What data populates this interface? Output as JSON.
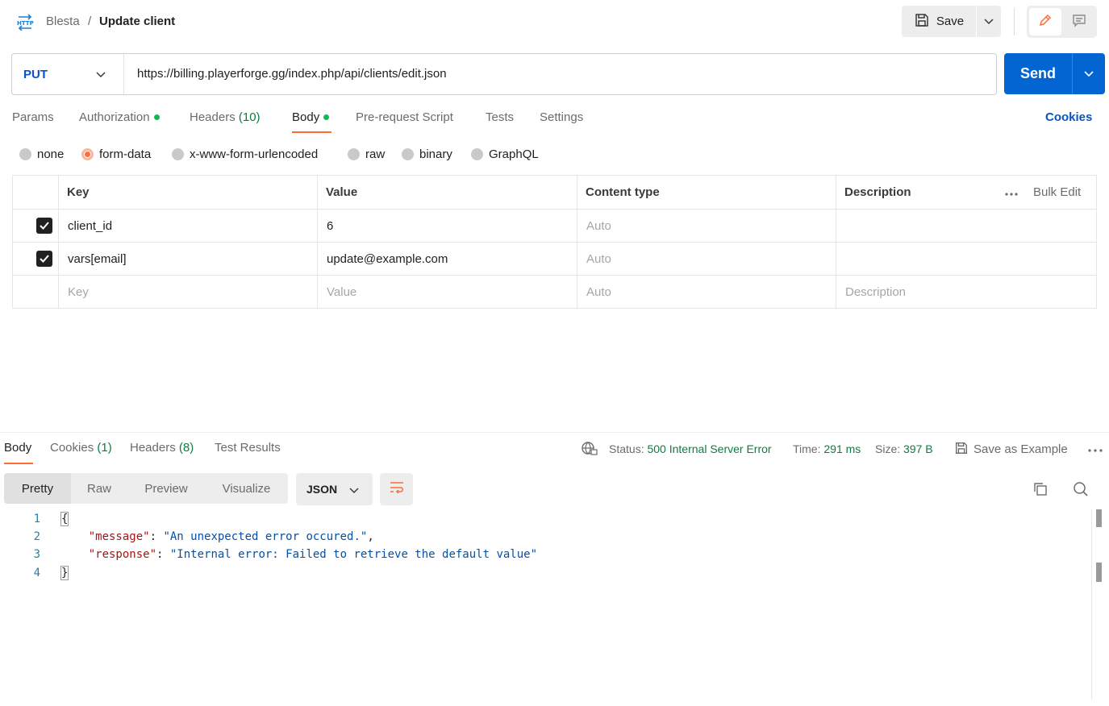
{
  "header": {
    "collection": "Blesta",
    "separator": "/",
    "title": "Update client",
    "save_label": "Save",
    "icons": {
      "request": "http-icon",
      "save": "floppy-disk-icon",
      "edit": "pencil-icon",
      "comments": "comment-icon"
    }
  },
  "request": {
    "method": "PUT",
    "url": "https://billing.playerforge.gg/index.php/api/clients/edit.json",
    "send_label": "Send"
  },
  "tabs": {
    "params": "Params",
    "authorization": "Authorization",
    "headers": "Headers",
    "headers_count": "(10)",
    "body": "Body",
    "pre_request": "Pre-request Script",
    "tests": "Tests",
    "settings": "Settings",
    "cookies": "Cookies"
  },
  "body_types": {
    "none": "none",
    "form_data": "form-data",
    "urlencoded": "x-www-form-urlencoded",
    "raw": "raw",
    "binary": "binary",
    "graphql": "GraphQL",
    "selected": "form-data"
  },
  "params_table": {
    "headers": {
      "key": "Key",
      "value": "Value",
      "content_type": "Content type",
      "description": "Description",
      "bulk_edit": "Bulk Edit"
    },
    "rows": [
      {
        "checked": true,
        "key": "client_id",
        "value": "6",
        "content_type": "Auto",
        "description": ""
      },
      {
        "checked": true,
        "key": "vars[email]",
        "value": "update@example.com",
        "content_type": "Auto",
        "description": ""
      }
    ],
    "placeholder": {
      "key": "Key",
      "value": "Value",
      "content_type": "Auto",
      "description": "Description"
    }
  },
  "response": {
    "tabs": {
      "body": "Body",
      "cookies": "Cookies",
      "cookies_count": "(1)",
      "headers": "Headers",
      "headers_count": "(8)",
      "test_results": "Test Results"
    },
    "status_label": "Status:",
    "status_value": "500 Internal Server Error",
    "time_label": "Time:",
    "time_value": "291 ms",
    "size_label": "Size:",
    "size_value": "397 B",
    "save_example": "Save as Example",
    "views": {
      "pretty": "Pretty",
      "raw": "Raw",
      "preview": "Preview",
      "visualize": "Visualize"
    },
    "format": "JSON",
    "code": {
      "line1": "{",
      "line2_key": "\"message\"",
      "line2_val": "\"An unexpected error occured.\"",
      "line3_key": "\"response\"",
      "line3_val": "\"Internal error: Failed to retrieve the default value\"",
      "line4": "}",
      "line_numbers": [
        "1",
        "2",
        "3",
        "4"
      ]
    }
  },
  "colors": {
    "accent": "#ff6c37",
    "send": "#0265d2",
    "method": "#0b53c3",
    "success": "#0f7b3f"
  }
}
